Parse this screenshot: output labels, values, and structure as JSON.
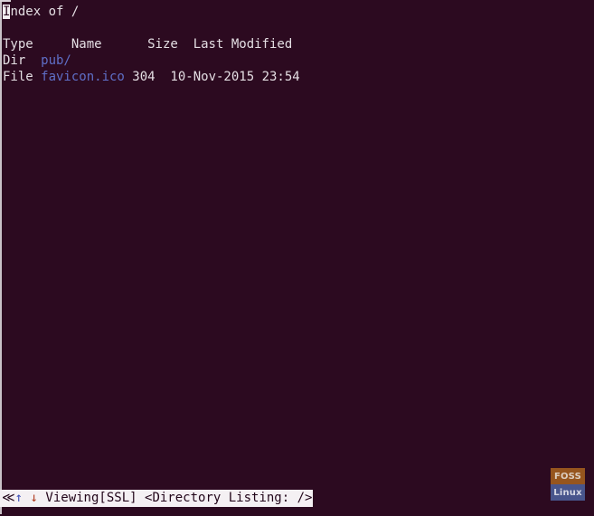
{
  "terminal": {
    "background_color": "#2c0a20",
    "foreground_color": "#e8e2e6",
    "link_color": "#5f6fc7",
    "cursor_color": "#f2eef1"
  },
  "page": {
    "title_prefix": "I",
    "title_rest": "ndex of /",
    "title_full": "Index of /"
  },
  "listing": {
    "headers": {
      "type": "Type",
      "name": "Name",
      "size": "Size",
      "last_modified": "Last Modified"
    },
    "rows": [
      {
        "type": "Dir",
        "name": "pub/",
        "size": "",
        "last_modified": "",
        "is_link": true
      },
      {
        "type": "File",
        "name": "favicon.ico",
        "size": "304",
        "last_modified": "10-Nov-2015 23:54",
        "is_link": true
      }
    ]
  },
  "status_bar": {
    "back_icon": "≪",
    "up_icon": "↑",
    "down_icon": "↓",
    "mode": "Viewing",
    "security": "[SSL]",
    "document_title": "<Directory Listing: />",
    "full_text": "≪↑ ↓ Viewing[SSL] <Directory Listing: />"
  },
  "watermark": {
    "line1": "FOSS",
    "line2": "Linux",
    "color_top": "#9c5a1e",
    "color_bottom": "#4a5a92"
  }
}
